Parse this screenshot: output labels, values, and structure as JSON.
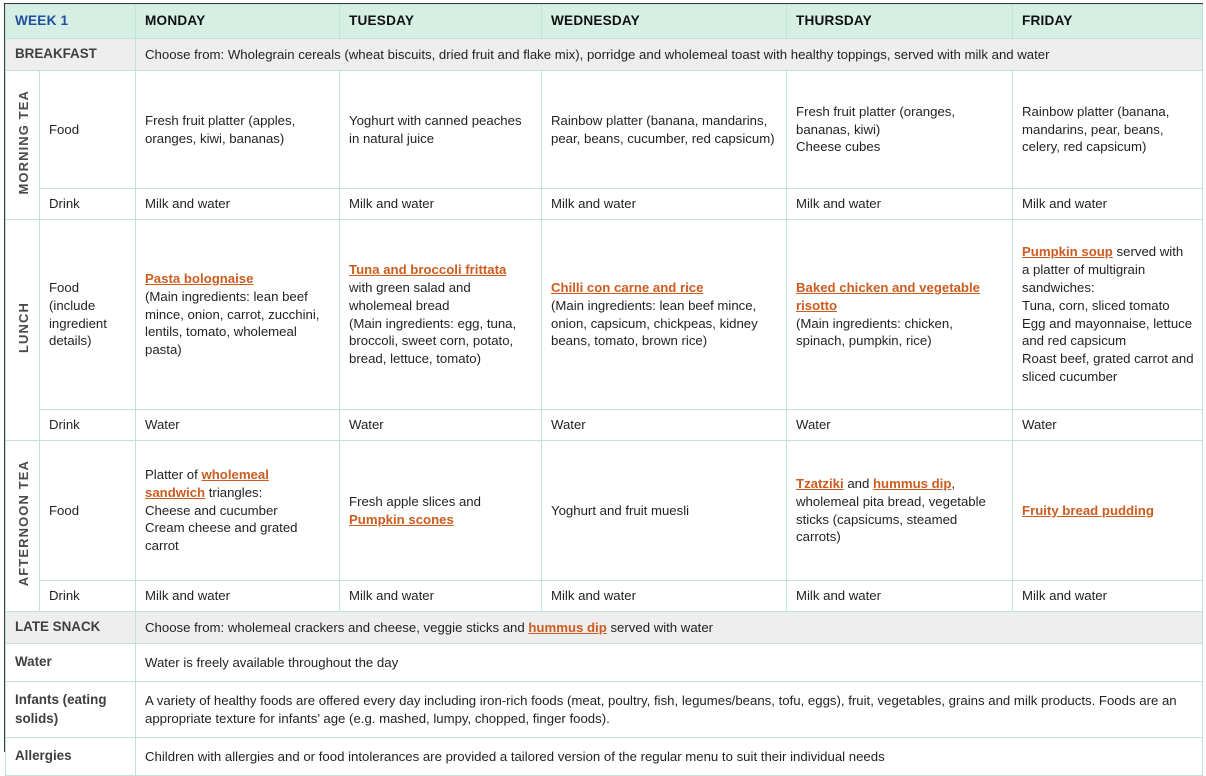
{
  "header": {
    "week_label": "WEEK 1",
    "days": [
      "MONDAY",
      "TUESDAY",
      "WEDNESDAY",
      "THURSDAY",
      "FRIDAY"
    ]
  },
  "colors": {
    "header_band": "#d6efe4",
    "grey_band": "#eeeeee",
    "grid_line": "#bfe3d4",
    "link_orange": "#cc5c20",
    "week_blue": "#1f4e9c",
    "outer_border": "#3a3a3a"
  },
  "breakfast": {
    "label": "BREAKFAST",
    "text": "Choose from:  Wholegrain cereals (wheat biscuits, dried fruit and flake mix), porridge and wholemeal toast with healthy toppings, served with milk and water"
  },
  "morning_tea": {
    "rail": "MORNING TEA",
    "food_label": "Food",
    "drink_label": "Drink",
    "food": [
      "Fresh fruit platter (apples, oranges, kiwi, bananas)",
      "Yoghurt with canned peaches in natural juice",
      "Rainbow platter (banana, mandarins, pear, beans, cucumber, red capsicum)",
      "Fresh fruit platter (oranges, bananas, kiwi)\nCheese cubes",
      "Rainbow platter (banana, mandarins, pear, beans, celery, red capsicum)"
    ],
    "drink": [
      "Milk and water",
      "Milk and water",
      "Milk and water",
      "Milk and water",
      "Milk and water"
    ]
  },
  "lunch": {
    "rail": "LUNCH",
    "food_label": "Food (include ingredient details)",
    "drink_label": "Drink",
    "food": [
      {
        "link": "Pasta bolognaise",
        "after": "\n(Main ingredients: lean beef mince, onion, carrot, zucchini, lentils, tomato, wholemeal pasta)"
      },
      {
        "link": "Tuna and broccoli frittata",
        "after": "\nwith green salad and wholemeal bread\n(Main ingredients: egg, tuna, broccoli, sweet corn, potato, bread, lettuce, tomato)"
      },
      {
        "link": "Chilli con carne and rice",
        "after": "\n(Main ingredients: lean beef mince, onion, capsicum, chickpeas, kidney beans, tomato, brown rice)"
      },
      {
        "link": "Baked chicken and vegetable risotto",
        "after": "\n(Main ingredients: chicken, spinach, pumpkin, rice)"
      },
      {
        "link": "Pumpkin soup",
        "after": " served with a platter of multigrain sandwiches:\nTuna, corn, sliced tomato\nEgg and mayonnaise, lettuce and red capsicum\nRoast beef, grated carrot and sliced cucumber"
      }
    ],
    "drink": [
      "Water",
      "Water",
      "Water",
      "Water",
      "Water"
    ]
  },
  "afternoon_tea": {
    "rail": "AFTERNOON TEA",
    "food_label": "Food",
    "drink_label": "Drink",
    "food": [
      {
        "before": "Platter of ",
        "link": "wholemeal sandwich",
        "after": " triangles:\nCheese and cucumber\nCream cheese and grated carrot"
      },
      {
        "before": "Fresh apple slices and\n",
        "link": "Pumpkin scones",
        "after": ""
      },
      {
        "before": "Yoghurt and fruit muesli",
        "link": "",
        "after": ""
      },
      {
        "before": "",
        "link": "Tzatziki",
        "mid": " and ",
        "link2": "hummus dip",
        "after": ",\nwholemeal pita bread, vegetable sticks (capsicums, steamed carrots)"
      },
      {
        "before": "",
        "link": "Fruity bread pudding",
        "after": ""
      }
    ],
    "drink": [
      "Milk and water",
      "Milk and water",
      "Milk and water",
      "Milk and water",
      "Milk and water"
    ]
  },
  "late_snack": {
    "label": "LATE SNACK",
    "before": "Choose from: wholemeal crackers and cheese, veggie sticks and ",
    "link": "hummus dip",
    "after": " served with water"
  },
  "water": {
    "label": "Water",
    "text": "Water is freely available throughout the day"
  },
  "infants": {
    "label": "Infants (eating solids)",
    "text": "A variety of healthy foods are offered every day including iron-rich foods (meat, poultry, fish, legumes/beans, tofu, eggs), fruit, vegetables, grains and milk products. Foods are an appropriate texture for infants’ age (e.g. mashed, lumpy, chopped, finger foods)."
  },
  "allergies": {
    "label": "Allergies",
    "text": "Children with allergies and or food intolerances are provided a tailored version of the regular menu to suit their individual needs"
  }
}
